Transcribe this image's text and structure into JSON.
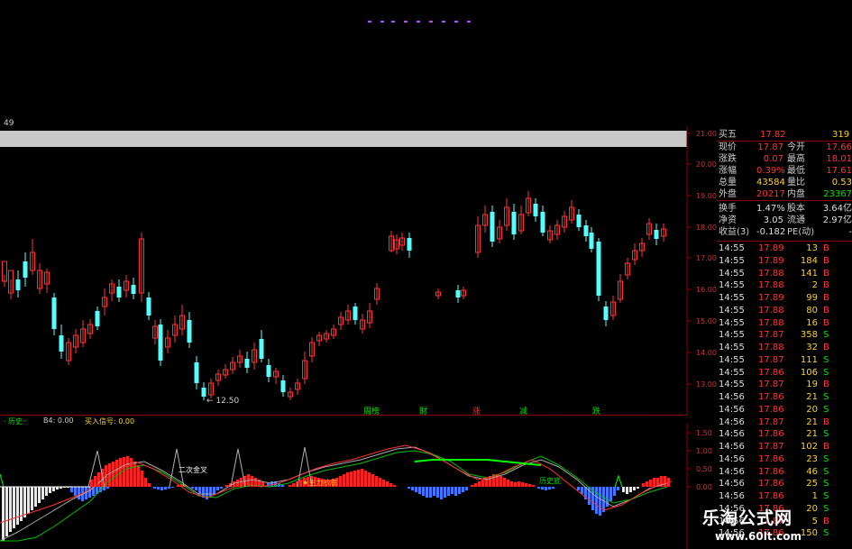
{
  "colors": {
    "up": "#ff3232",
    "down": "#54ffff",
    "axis": "#8b0000",
    "bar_gray": "#c8c8c8",
    "green": "#00e000",
    "yellow": "#ffd21e",
    "label": "#cccccc",
    "white": "#ffffff"
  },
  "top_left_number": "49",
  "price_axis": {
    "labels": [
      "21.00",
      "20.00",
      "19.00",
      "18.00",
      "17.00",
      "16.00",
      "15.00",
      "14.00",
      "13.00"
    ]
  },
  "markers": [
    {
      "label": "周榜"
    },
    {
      "label": "財"
    },
    {
      "label": "涨"
    },
    {
      "label": "减"
    },
    {
      "label": "跌"
    }
  ],
  "low_annotation": "12.50",
  "indicator": {
    "header": [
      {
        "text": "·  历史··"
      },
      {
        "text": "B4: 0.00"
      },
      {
        "text": "买入信号: 0.00"
      }
    ],
    "labels": [
      {
        "text": "二次金叉"
      },
      {
        "text": "★主力抄底"
      },
      {
        "text": "历史底"
      }
    ],
    "axis": [
      "1.50",
      "1.00",
      "0.50",
      "0.00"
    ]
  },
  "quote": {
    "ask5": {
      "label": "买五",
      "price": "17.82",
      "vol": "319"
    },
    "rows": [
      {
        "l1": "现价",
        "v1": "17.87",
        "l2": "今开",
        "v2": "17.66"
      },
      {
        "l1": "涨跌",
        "v1": "0.07",
        "l2": "最高",
        "v2": "18.01"
      },
      {
        "l1": "涨幅",
        "v1": "0.39%",
        "l2": "最低",
        "v2": "17.61"
      },
      {
        "l1": "总量",
        "v1": "43584",
        "l2": "量比",
        "v2": "0.53"
      },
      {
        "l1": "外盘",
        "v1": "20217",
        "l2": "内盘",
        "v2": "23367"
      },
      {
        "l1": "换手",
        "v1": "1.47%",
        "l2": "股本",
        "v2": "3.64亿"
      },
      {
        "l1": "净资",
        "v1": "3.05",
        "l2": "流通",
        "v2": "2.97亿"
      },
      {
        "l1": "收益(3)",
        "v1": "-0.182",
        "l2": "PE(动)",
        "v2": "-"
      }
    ]
  },
  "ticks": [
    {
      "time": "14:55",
      "price": "17.89",
      "vol": "13",
      "side": "B"
    },
    {
      "time": "14:55",
      "price": "17.89",
      "vol": "184",
      "side": "B"
    },
    {
      "time": "14:55",
      "price": "17.88",
      "vol": "141",
      "side": "B"
    },
    {
      "time": "14:55",
      "price": "17.88",
      "vol": "2",
      "side": "B"
    },
    {
      "time": "14:55",
      "price": "17.89",
      "vol": "99",
      "side": "B"
    },
    {
      "time": "14:55",
      "price": "17.88",
      "vol": "80",
      "side": "B"
    },
    {
      "time": "14:55",
      "price": "17.88",
      "vol": "16",
      "side": "B"
    },
    {
      "time": "14:55",
      "price": "17.87",
      "vol": "358",
      "side": "S"
    },
    {
      "time": "14:55",
      "price": "17.88",
      "vol": "32",
      "side": "B"
    },
    {
      "time": "14:55",
      "price": "17.87",
      "vol": "111",
      "side": "S"
    },
    {
      "time": "14:55",
      "price": "17.86",
      "vol": "106",
      "side": "S"
    },
    {
      "time": "14:55",
      "price": "17.87",
      "vol": "19",
      "side": "B"
    },
    {
      "time": "14:56",
      "price": "17.86",
      "vol": "21",
      "side": "S"
    },
    {
      "time": "14:56",
      "price": "17.86",
      "vol": "20",
      "side": "S"
    },
    {
      "time": "14:56",
      "price": "17.87",
      "vol": "21",
      "side": "B"
    },
    {
      "time": "14:56",
      "price": "17.86",
      "vol": "21",
      "side": "S"
    },
    {
      "time": "14:56",
      "price": "17.87",
      "vol": "102",
      "side": "B"
    },
    {
      "time": "14:56",
      "price": "17.86",
      "vol": "23",
      "side": "S"
    },
    {
      "time": "14:56",
      "price": "17.86",
      "vol": "46",
      "side": "S"
    },
    {
      "time": "14:56",
      "price": "17.86",
      "vol": "25",
      "side": "S"
    },
    {
      "time": "14:56",
      "price": "17.86",
      "vol": "1",
      "side": "S"
    },
    {
      "time": "14:56",
      "price": "17.86",
      "vol": "20",
      "side": "S"
    },
    {
      "time": "14:56",
      "price": "17.87",
      "vol": "5",
      "side": "B"
    },
    {
      "time": "14:56",
      "price": "17.86",
      "vol": "150",
      "side": "S"
    }
  ],
  "watermark": {
    "title": "乐淘公式网",
    "url": "www.60lt.com"
  }
}
